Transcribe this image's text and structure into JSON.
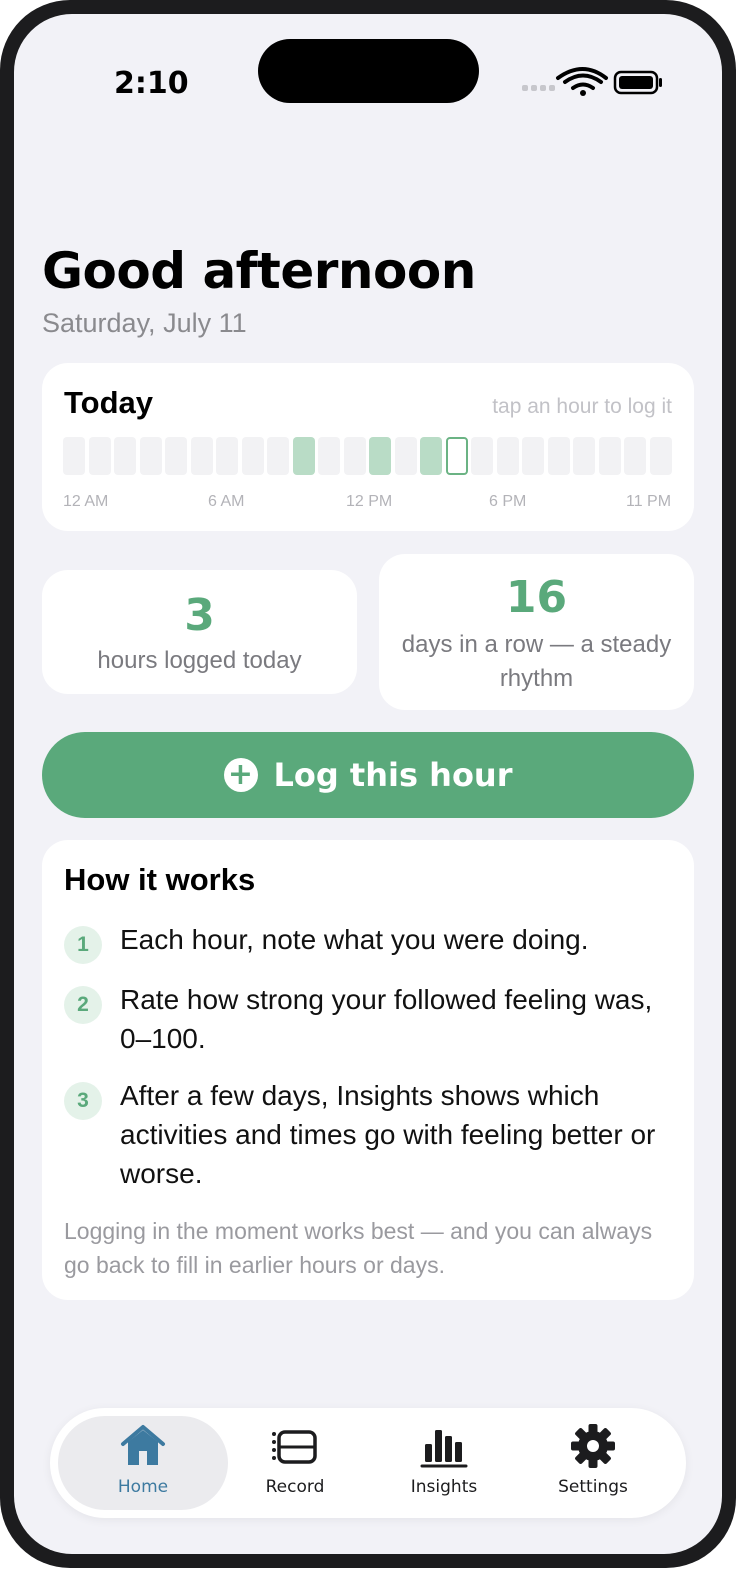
{
  "status_bar": {
    "time": "2:10"
  },
  "header": {
    "greeting": "Good afternoon",
    "date": "Saturday, July 11"
  },
  "today": {
    "title": "Today",
    "hint": "tap an hour to log it",
    "hour_states": [
      "empty",
      "empty",
      "empty",
      "empty",
      "empty",
      "empty",
      "empty",
      "empty",
      "empty",
      "logged",
      "empty",
      "empty",
      "logged",
      "empty",
      "logged",
      "current",
      "empty",
      "empty",
      "empty",
      "empty",
      "empty",
      "empty",
      "empty",
      "empty"
    ],
    "axis_labels": [
      "12 AM",
      "6 AM",
      "12 PM",
      "6 PM",
      "11 PM"
    ]
  },
  "stats": {
    "hours_logged": {
      "value": "3",
      "label": "hours logged today"
    },
    "streak": {
      "value": "16",
      "label": "days in a row — a steady rhythm"
    }
  },
  "log_button": {
    "label": "Log this hour",
    "icon": "plus-circle-icon"
  },
  "how_it_works": {
    "title": "How it works",
    "steps": [
      {
        "num": "1",
        "text": "Each hour, note what you were doing."
      },
      {
        "num": "2",
        "text": "Rate how strong your followed feeling was, 0–100."
      },
      {
        "num": "3",
        "text": "After a few days, Insights shows which activities and times go with feeling better or worse."
      }
    ],
    "note": "Logging in the moment works best — and you can always go back to fill in earlier hours or days."
  },
  "tabbar": {
    "tabs": [
      {
        "label": "Home",
        "icon": "house-icon",
        "active": true
      },
      {
        "label": "Record",
        "icon": "record-icon",
        "active": false
      },
      {
        "label": "Insights",
        "icon": "bar-chart-icon",
        "active": false
      },
      {
        "label": "Settings",
        "icon": "gear-icon",
        "active": false
      }
    ]
  },
  "colors": {
    "accent": "#5aa97b",
    "logged": "#b9dcc6",
    "background": "#f2f2f7",
    "active_tab": "#3d7aa0"
  }
}
